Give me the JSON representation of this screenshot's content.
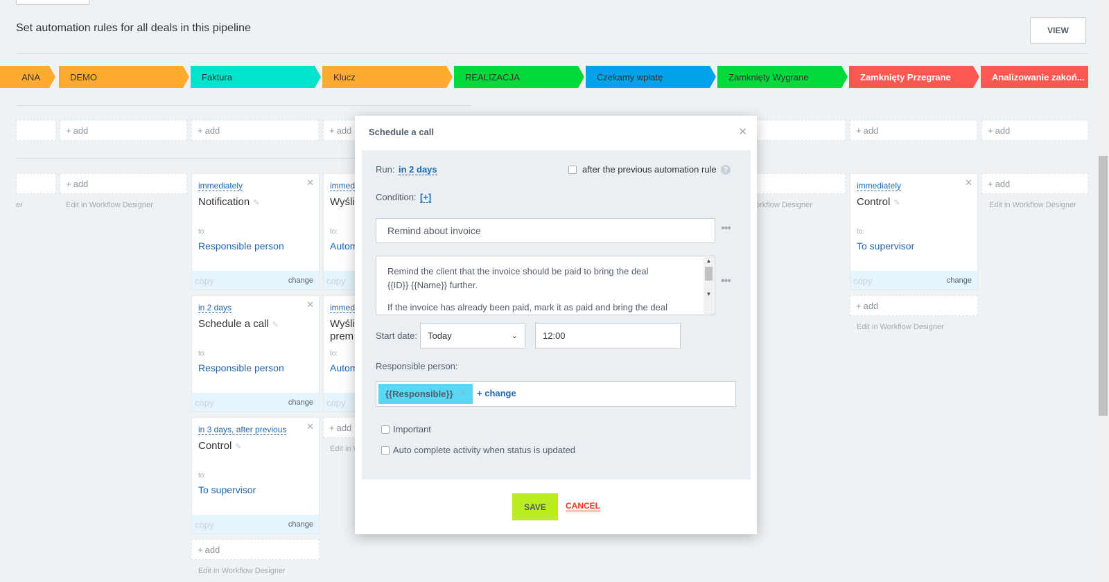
{
  "header": {
    "title": "Set automation rules for all deals in this pipeline",
    "view_label": "VIEW"
  },
  "stages": [
    {
      "label": "ANA",
      "color": "#ffab2e"
    },
    {
      "label": "DEMO",
      "color": "#ffab2e"
    },
    {
      "label": "Faktura",
      "color": "#00e3cd"
    },
    {
      "label": "Klucz",
      "color": "#ffab2e"
    },
    {
      "label": "REALIZACJA",
      "color": "#00d93b"
    },
    {
      "label": "Czekamy wpłatę",
      "color": "#00a2ea"
    },
    {
      "label": "Zamknięty Wygrane",
      "color": "#00d93b"
    },
    {
      "label": "Zamknięty Przegrane",
      "color": "#ff5752"
    },
    {
      "label": "Analizowanie zakoń...",
      "color": "#ff5752"
    }
  ],
  "common": {
    "add_label": "add",
    "edit_label": "Edit in Workflow Designer",
    "edit_label_partial_left": "er",
    "edit_label_partial_mid": "Edit in W",
    "edit_label_partial_right": "orkflow Designer",
    "copy_label": "copy",
    "change_label": "change",
    "to_label": "to:"
  },
  "cards": {
    "c1": {
      "when": "immediately",
      "title": "Notification",
      "who": "Responsible person"
    },
    "c2": {
      "when": "in 2 days",
      "title": "Schedule a call",
      "who": "Responsible person"
    },
    "c3": {
      "when": "in 3 days, after previous",
      "title": "Control",
      "who": "To supervisor"
    },
    "c4": {
      "when": "immed",
      "title": "Wyśli",
      "who": "Autom"
    },
    "c5": {
      "when": "immed",
      "title": "Wyśli",
      "title2": "prem",
      "who": "Autom"
    },
    "c6": {
      "when": "immediately",
      "title": "Control",
      "who": "To supervisor"
    }
  },
  "dialog": {
    "title": "Schedule a call",
    "run_label": "Run:",
    "run_value": "in 2 days",
    "after_previous_label": "after the previous automation rule",
    "condition_label": "Condition:",
    "condition_value": "[+]",
    "subject_value": "Remind about invoice",
    "description_line1": "Remind the client that the invoice should be paid to bring the deal",
    "description_line2": "{{ID}} {{Name}} further.",
    "description_line3": "If the invoice has already been paid, mark it as paid and bring the deal",
    "start_date_label": "Start date:",
    "start_date_value": "Today",
    "time_value": "12:00",
    "responsible_label": "Responsible person:",
    "responsible_tag": "{{Responsible}}",
    "change_label": "change",
    "important_label": "Important",
    "auto_complete_label": "Auto complete activity when status is updated",
    "save_label": "SAVE",
    "cancel_label": "CANCEL"
  }
}
